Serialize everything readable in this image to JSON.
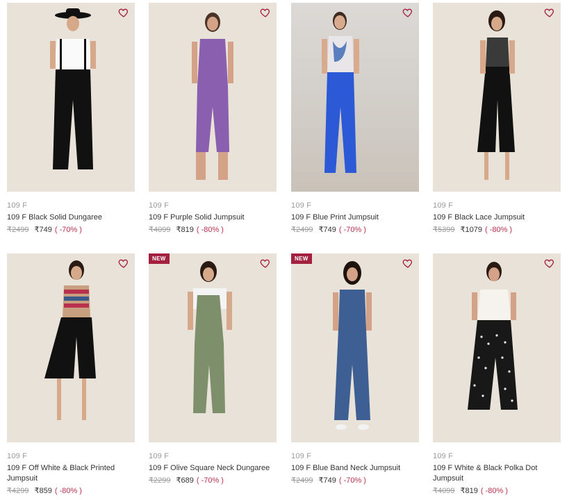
{
  "colors": {
    "accent": "#a3213f",
    "discount": "#b8324f",
    "muted": "#9a9a9a",
    "text": "#333333"
  },
  "products": [
    {
      "brand": "109 F",
      "name": "109 F Black Solid Dungaree",
      "mrp": "₹2499",
      "price": "₹749",
      "discount": "( -70% )",
      "badge": "",
      "wishlist_icon": "heart-outline-icon"
    },
    {
      "brand": "109 F",
      "name": "109 F Purple Solid Jumpsuit",
      "mrp": "₹4099",
      "price": "₹819",
      "discount": "( -80% )",
      "badge": "",
      "wishlist_icon": "heart-outline-icon"
    },
    {
      "brand": "109 F",
      "name": "109 F Blue Print Jumpsuit",
      "mrp": "₹2499",
      "price": "₹749",
      "discount": "( -70% )",
      "badge": "",
      "wishlist_icon": "heart-outline-icon"
    },
    {
      "brand": "109 F",
      "name": "109 F Black Lace Jumpsuit",
      "mrp": "₹5399",
      "price": "₹1079",
      "discount": "( -80% )",
      "badge": "",
      "wishlist_icon": "heart-outline-icon"
    },
    {
      "brand": "109 F",
      "name": "109 F Off White & Black Printed Jumpsuit",
      "mrp": "₹4299",
      "price": "₹859",
      "discount": "( -80% )",
      "badge": "",
      "wishlist_icon": "heart-outline-icon"
    },
    {
      "brand": "109 F",
      "name": "109 F Olive Square Neck Dungaree",
      "mrp": "₹2299",
      "price": "₹689",
      "discount": "( -70% )",
      "badge": "NEW",
      "wishlist_icon": "heart-outline-icon"
    },
    {
      "brand": "109 F",
      "name": "109 F Blue Band Neck Jumpsuit",
      "mrp": "₹2499",
      "price": "₹749",
      "discount": "( -70% )",
      "badge": "NEW",
      "wishlist_icon": "heart-outline-icon"
    },
    {
      "brand": "109 F",
      "name": "109 F White & Black Polka Dot Jumpsuit",
      "mrp": "₹4099",
      "price": "₹819",
      "discount": "( -80% )",
      "badge": "",
      "wishlist_icon": "heart-outline-icon"
    }
  ]
}
